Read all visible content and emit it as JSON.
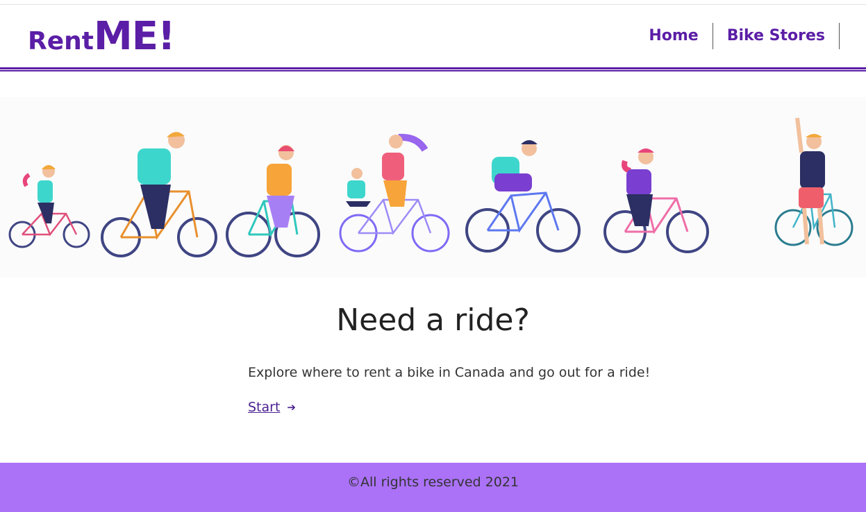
{
  "brand": {
    "part1": "Rent",
    "part2": "ME!"
  },
  "nav": {
    "items": [
      "Home",
      "Bike Stores"
    ]
  },
  "hero": {
    "alt": "people riding bicycles illustration"
  },
  "main": {
    "title": "Need a ride?",
    "description": "Explore where to rent a bike in Canada and go out for a ride!",
    "start_label": "Start"
  },
  "footer": {
    "text": "©All rights reserved 2021"
  },
  "colors": {
    "brand": "#5b1ea6",
    "footer_bg": "#ab72f8"
  }
}
